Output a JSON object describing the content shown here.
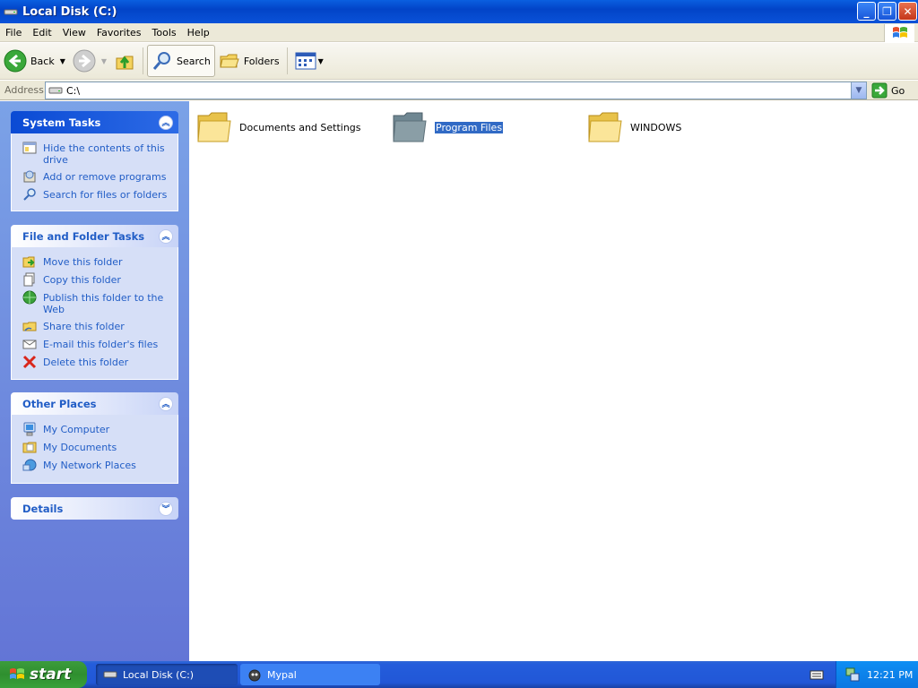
{
  "window": {
    "title": "Local Disk (C:)",
    "icons": {
      "app": "drive-icon",
      "minimize": "minimize-icon",
      "maximize": "restore-icon",
      "close": "close-icon"
    }
  },
  "menu": [
    "File",
    "Edit",
    "View",
    "Favorites",
    "Tools",
    "Help"
  ],
  "toolbar": {
    "back_label": "Back",
    "search_label": "Search",
    "folders_label": "Folders"
  },
  "address": {
    "label": "Address",
    "value": "C:\\",
    "go_label": "Go"
  },
  "task_pane": {
    "system_tasks": {
      "title": "System Tasks",
      "items": [
        "Hide the contents of this drive",
        "Add or remove programs",
        "Search for files or folders"
      ]
    },
    "file_folder_tasks": {
      "title": "File and Folder Tasks",
      "items": [
        "Move this folder",
        "Copy this folder",
        "Publish this folder to the Web",
        "Share this folder",
        "E-mail this folder's files",
        "Delete this folder"
      ]
    },
    "other_places": {
      "title": "Other Places",
      "items": [
        "My Computer",
        "My Documents",
        "My Network Places"
      ]
    },
    "details": {
      "title": "Details"
    }
  },
  "files": [
    {
      "name": "Documents and Settings",
      "selected": false
    },
    {
      "name": "Program Files",
      "selected": true
    },
    {
      "name": "WINDOWS",
      "selected": false
    }
  ],
  "taskbar": {
    "start_label": "start",
    "tasks": [
      "Local Disk (C:)",
      "Mypal"
    ],
    "clock": "12:21 PM"
  },
  "colors": {
    "titlebar": "#0a52d8",
    "task_link": "#215dc6",
    "selection": "#316ac5",
    "start_green": "#3aa13a"
  }
}
